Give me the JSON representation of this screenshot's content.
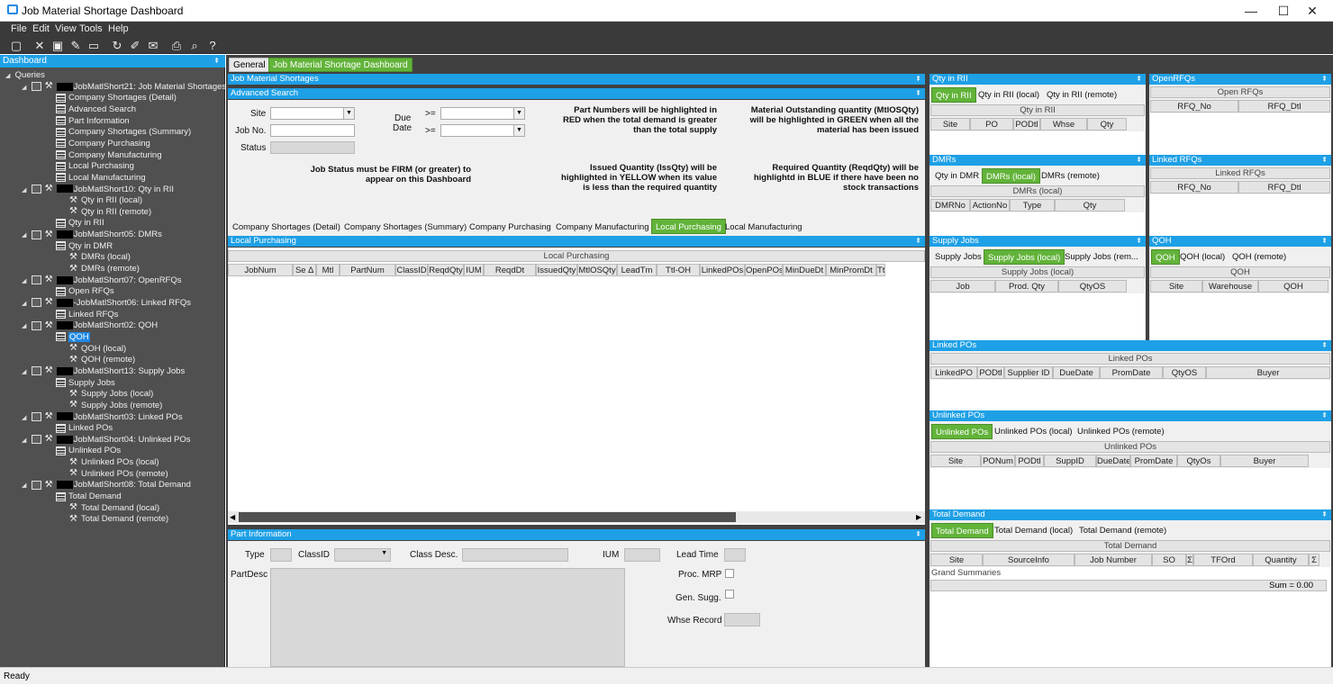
{
  "window": {
    "title": "Job Material Shortage Dashboard",
    "min": "—",
    "max": "☐",
    "close": "✕"
  },
  "menu": [
    "File",
    "Edit",
    "View",
    "Tools",
    "Help"
  ],
  "left": {
    "header": "Dashboard",
    "pin": "⇞",
    "tree": [
      {
        "t": "Queries",
        "lvl": 0,
        "ico": "none",
        "exp": "◢"
      },
      {
        "t": "JobMatlShort21: Job Material Shortages",
        "lvl": 1,
        "ico": "q",
        "exp": "◢",
        "blk": true
      },
      {
        "t": "Company Shortages (Detail)",
        "lvl": 2,
        "ico": "g"
      },
      {
        "t": "Advanced Search",
        "lvl": 2,
        "ico": "g"
      },
      {
        "t": "Part Information",
        "lvl": 2,
        "ico": "g"
      },
      {
        "t": "Company Shortages (Summary)",
        "lvl": 2,
        "ico": "g"
      },
      {
        "t": "Company Purchasing",
        "lvl": 2,
        "ico": "g"
      },
      {
        "t": "Company Manufacturing",
        "lvl": 2,
        "ico": "g"
      },
      {
        "t": "Local Purchasing",
        "lvl": 2,
        "ico": "g"
      },
      {
        "t": "Local Manufacturing",
        "lvl": 2,
        "ico": "g"
      },
      {
        "t": "JobMatlShort10: Qty in RII",
        "lvl": 1,
        "ico": "q",
        "exp": "◢",
        "blk": true
      },
      {
        "t": "Qty in RII (local)",
        "lvl": 3,
        "ico": "w"
      },
      {
        "t": "Qty in RII (remote)",
        "lvl": 3,
        "ico": "w"
      },
      {
        "t": "Qty in RII",
        "lvl": 2,
        "ico": "g"
      },
      {
        "t": "JobMatlShort05: DMRs",
        "lvl": 1,
        "ico": "q",
        "exp": "◢",
        "blk": true
      },
      {
        "t": "Qty in DMR",
        "lvl": 2,
        "ico": "g"
      },
      {
        "t": "DMRs (local)",
        "lvl": 3,
        "ico": "w"
      },
      {
        "t": "DMRs (remote)",
        "lvl": 3,
        "ico": "w"
      },
      {
        "t": "JobMatlShort07: OpenRFQs",
        "lvl": 1,
        "ico": "q",
        "exp": "◢",
        "blk": true
      },
      {
        "t": "Open RFQs",
        "lvl": 2,
        "ico": "g"
      },
      {
        "t": "-JobMatlShort06: Linked RFQs",
        "lvl": 1,
        "ico": "q",
        "exp": "◢",
        "blk": true
      },
      {
        "t": "Linked RFQs",
        "lvl": 2,
        "ico": "g"
      },
      {
        "t": "JobMatlShort02: QOH",
        "lvl": 1,
        "ico": "q",
        "exp": "◢",
        "blk": true
      },
      {
        "t": "QOH",
        "lvl": 2,
        "ico": "g",
        "sel": true
      },
      {
        "t": "QOH (local)",
        "lvl": 3,
        "ico": "w"
      },
      {
        "t": "QOH (remote)",
        "lvl": 3,
        "ico": "w"
      },
      {
        "t": "JobMatlShort13: Supply Jobs",
        "lvl": 1,
        "ico": "q",
        "exp": "◢",
        "blk": true
      },
      {
        "t": "Supply Jobs",
        "lvl": 2,
        "ico": "g"
      },
      {
        "t": "Supply Jobs (local)",
        "lvl": 3,
        "ico": "w"
      },
      {
        "t": "Supply Jobs (remote)",
        "lvl": 3,
        "ico": "w"
      },
      {
        "t": "JobMatlShort03: Linked POs",
        "lvl": 1,
        "ico": "q",
        "exp": "◢",
        "blk": true
      },
      {
        "t": "Linked POs",
        "lvl": 2,
        "ico": "g"
      },
      {
        "t": "JobMatlShort04: Unlinked POs",
        "lvl": 1,
        "ico": "q",
        "exp": "◢",
        "blk": true
      },
      {
        "t": "Unlinked POs",
        "lvl": 2,
        "ico": "g"
      },
      {
        "t": "Unlinked POs (local)",
        "lvl": 3,
        "ico": "w"
      },
      {
        "t": "Unlinked POs (remote)",
        "lvl": 3,
        "ico": "w"
      },
      {
        "t": "JobMatlShort08: Total Demand",
        "lvl": 1,
        "ico": "q",
        "exp": "◢",
        "blk": true
      },
      {
        "t": "Total Demand",
        "lvl": 2,
        "ico": "g"
      },
      {
        "t": "Total Demand (local)",
        "lvl": 3,
        "ico": "w"
      },
      {
        "t": "Total Demand (remote)",
        "lvl": 3,
        "ico": "w"
      }
    ]
  },
  "tabs": {
    "general": "General",
    "dash": "Job Material Shortage Dashboard"
  },
  "jms": {
    "header": "Job Material Shortages",
    "adv": "Advanced Search",
    "site": "Site",
    "jobno": "Job No.",
    "status": "Status",
    "due": "Due",
    "date": "Date",
    "ge": ">=",
    "note1": "Part Numbers will be highlighted in RED when the total demand is greater than the total supply",
    "note2": "Material Outstanding quantity (MtlOSQty) will be highlighted in GREEN when all the material has been issued",
    "note3": "Job Status must be FIRM (or greater) to appear on this Dashboard",
    "note4": "Issued Quantity (IssQty) will be highlighted in YELLOW when its value is less than the required quantity",
    "note5": "Required Quantity (ReqdQty) will be highlightd in BLUE if there have been no stock transactions"
  },
  "subtabs": [
    "Company Shortages (Detail)",
    "Company Shortages (Summary)",
    "Company Purchasing",
    "Company Manufacturing",
    "Local Purchasing",
    "Local Manufacturing"
  ],
  "lp": {
    "header": "Local Purchasing",
    "grid_title": "Local Purchasing",
    "cols": [
      "JobNum",
      "Se ∆",
      "Mtl",
      "PartNum",
      "ClassID",
      "ReqdQty",
      "IUM",
      "ReqdDt",
      "IssuedQty",
      "MtlOSQty",
      "LeadTm",
      "Ttl-OH",
      "LinkedPOs",
      "OpenPOs",
      "MinDueDt",
      "MinPromDt",
      "Ttl"
    ]
  },
  "pi": {
    "header": "Part Information",
    "type": "Type",
    "classid": "ClassID",
    "classdesc": "Class Desc.",
    "ium": "IUM",
    "leadtime": "Lead Time",
    "partdesc": "PartDesc",
    "procmrp": "Proc. MRP",
    "gensugg": "Gen. Sugg.",
    "whse": "Whse Record"
  },
  "rii": {
    "header": "Qty in RII",
    "tabs": [
      "Qty in RII",
      "Qty in RII (local)",
      "Qty in RII (remote)"
    ],
    "grid": "Qty in RII",
    "cols": [
      "Site",
      "PO",
      "PODtl",
      "Whse",
      "Qty"
    ]
  },
  "rfq": {
    "header": "OpenRFQs",
    "grid": "Open RFQs",
    "cols": [
      "RFQ_No",
      "RFQ_Dtl"
    ]
  },
  "dmr": {
    "header": "DMRs",
    "tabs": [
      "Qty in DMR",
      "DMRs (local)",
      "DMRs (remote)"
    ],
    "grid": "DMRs (local)",
    "cols": [
      "DMRNo",
      "ActionNo",
      "Type",
      "Qty"
    ]
  },
  "lrfq": {
    "header": "Linked RFQs",
    "grid": "Linked RFQs",
    "cols": [
      "RFQ_No",
      "RFQ_Dtl"
    ]
  },
  "sj": {
    "header": "Supply Jobs",
    "tabs": [
      "Supply Jobs",
      "Supply Jobs (local)",
      "Supply Jobs (rem..."
    ],
    "grid": "Supply Jobs (local)",
    "cols": [
      "Job",
      "Prod. Qty",
      "QtyOS"
    ]
  },
  "qoh": {
    "header": "QOH",
    "tabs": [
      "QOH",
      "QOH (local)",
      "QOH (remote)"
    ],
    "grid": "QOH",
    "cols": [
      "Site",
      "Warehouse",
      "QOH"
    ]
  },
  "lpo": {
    "header": "Linked POs",
    "grid": "Linked POs",
    "cols": [
      "LinkedPO",
      "PODtl",
      "Supplier ID",
      "DueDate",
      "PromDate",
      "QtyOS",
      "Buyer"
    ]
  },
  "upo": {
    "header": "Unlinked POs",
    "tabs": [
      "Unlinked POs",
      "Unlinked POs (local)",
      "Unlinked POs (remote)"
    ],
    "grid": "Unlinked POs",
    "cols": [
      "Site",
      "PONum",
      "PODtl",
      "SuppID",
      "DueDate",
      "PromDate",
      "QtyOs",
      "Buyer"
    ]
  },
  "td": {
    "header": "Total Demand",
    "tabs": [
      "Total Demand",
      "Total Demand (local)",
      "Total Demand (remote)"
    ],
    "grid": "Total Demand",
    "cols": [
      "Site",
      "SourceInfo",
      "Job Number",
      "SO",
      "Σ",
      "TFOrd",
      "Quantity",
      "Σ"
    ],
    "grand": "Grand Summaries",
    "sum": "Sum = 0.00"
  },
  "status": "Ready"
}
